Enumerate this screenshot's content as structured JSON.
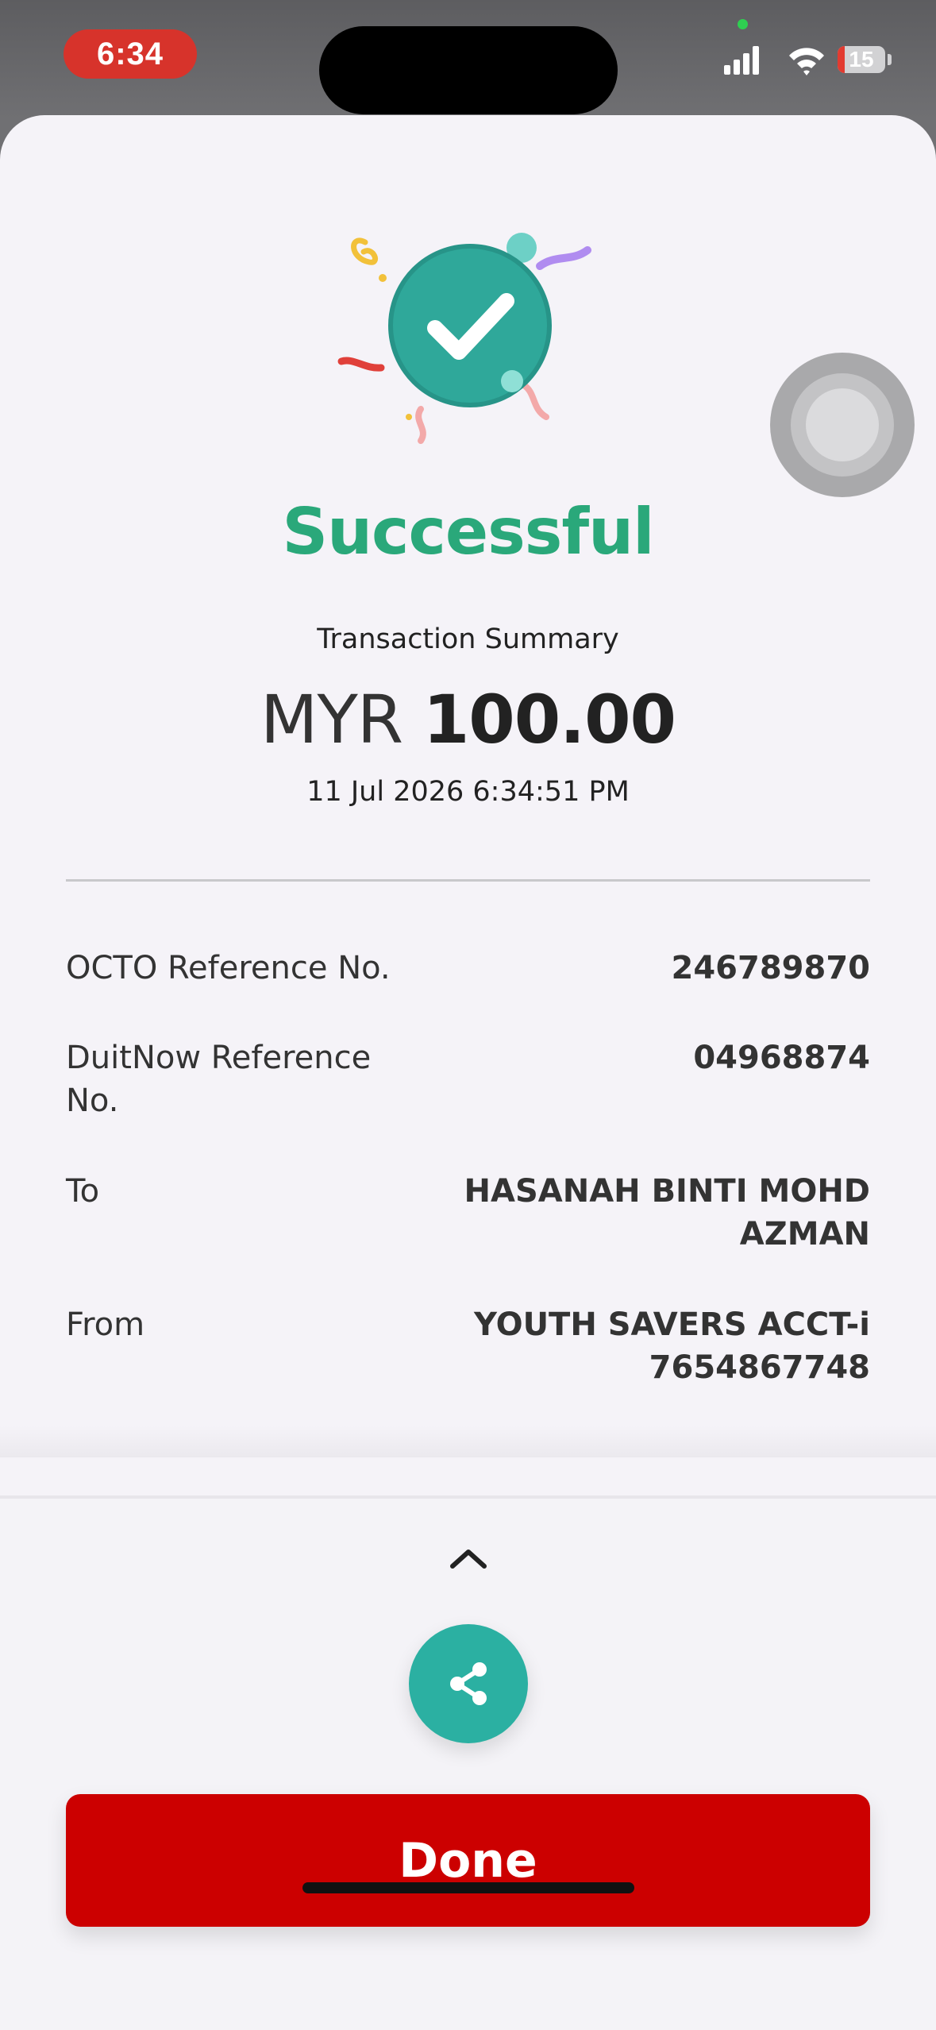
{
  "status_bar": {
    "time": "6:34",
    "battery": "15",
    "battery_level": 0.15,
    "signal_icon": "cellular-signal-icon",
    "wifi_icon": "wifi-icon"
  },
  "result": {
    "status": "Successful",
    "icon": "checkmark-celebration-icon",
    "summary_label": "Transaction Summary",
    "currency": "MYR",
    "amount": "100.00",
    "datetime": "11 Jul 2026 6:34:51 PM"
  },
  "details": [
    {
      "label": "OCTO Reference No.",
      "value": "246789870"
    },
    {
      "label": "DuitNow Reference No.",
      "value": "04968874"
    },
    {
      "label": "To",
      "value": "HASANAH BINTI MOHD AZMAN"
    },
    {
      "label": "From",
      "value": "YOUTH SAVERS ACCT-i 7654867748"
    }
  ],
  "actions": {
    "expand_icon": "chevron-up-icon",
    "share_icon": "share-icon",
    "done_label": "Done"
  },
  "colors": {
    "brand_red": "#cc0000",
    "success_green": "#2aa87a",
    "teal": "#2bb0a2",
    "time_pill": "#d7332b"
  }
}
